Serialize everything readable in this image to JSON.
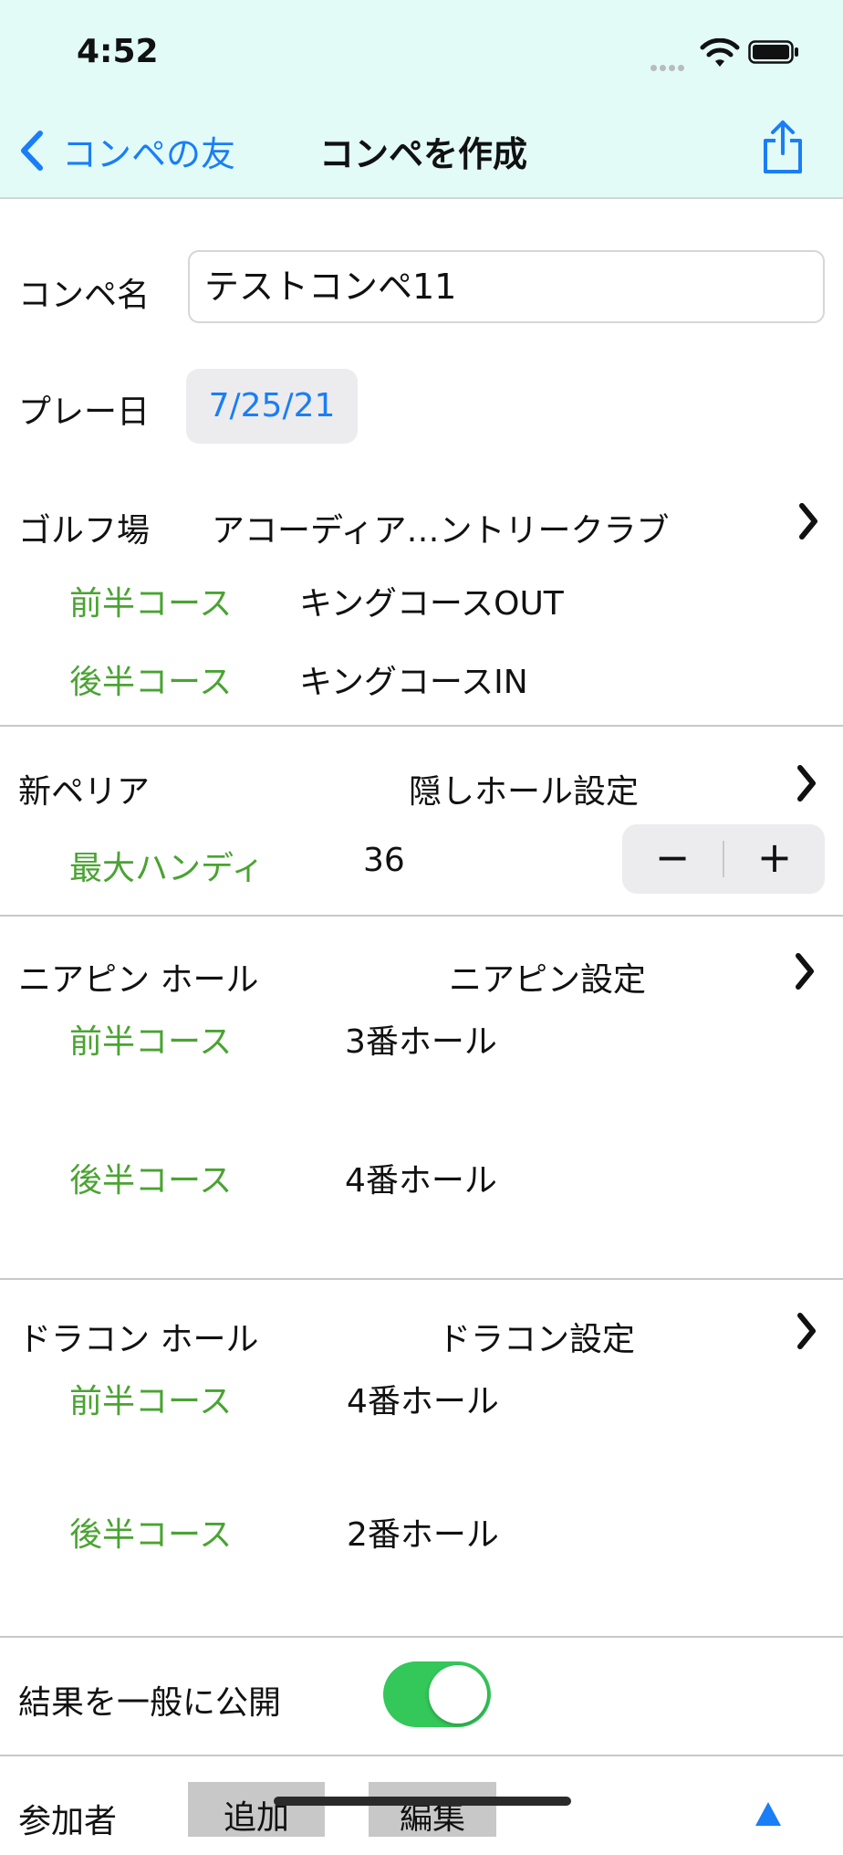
{
  "status_bar": {
    "time": "4:52"
  },
  "nav": {
    "back_label": "コンペの友",
    "title": "コンペを作成"
  },
  "form": {
    "name_label": "コンペ名",
    "name_value": "テストコンペ11",
    "date_label": "プレー日",
    "date_value": "7/25/21",
    "golf_label": "ゴルフ場",
    "golf_value": "アコーディア…ントリークラブ",
    "front_course_label": "前半コース",
    "front_course_value": "キングコースOUT",
    "back_course_label": "後半コース",
    "back_course_value": "キングコースIN"
  },
  "peria": {
    "label": "新ペリア",
    "hidden_hole_label": "隠しホール設定",
    "max_handicap_label": "最大ハンディ",
    "max_handicap_value": "36",
    "minus": "−",
    "plus": "+"
  },
  "nearpin": {
    "label": "ニアピン ホール",
    "settings_label": "ニアピン設定",
    "front_label": "前半コース",
    "front_value": "3番ホール",
    "back_label": "後半コース",
    "back_value": "4番ホール"
  },
  "drive": {
    "label": "ドラコン ホール",
    "settings_label": "ドラコン設定",
    "front_label": "前半コース",
    "front_value": "4番ホール",
    "back_label": "後半コース",
    "back_value": "2番ホール"
  },
  "publish": {
    "label": "結果を一般に公開",
    "enabled": true,
    "on_color": "#34c759"
  },
  "participants": {
    "label": "参加者",
    "add_button": "追加",
    "edit_button": "編集"
  },
  "colors": {
    "accent": "#1a7ef6",
    "green_label": "#4aa332",
    "header_bg": "#e2fbf7"
  }
}
